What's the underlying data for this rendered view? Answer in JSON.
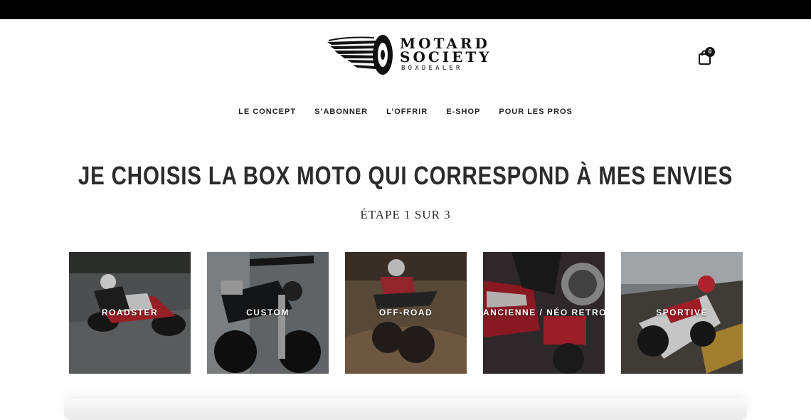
{
  "header": {
    "brand_line1": "MOTARD",
    "brand_line2": "SOCIETY",
    "brand_line3": "BOXDEALER",
    "cart_count": "0"
  },
  "nav": {
    "items": [
      {
        "label": "LE CONCEPT"
      },
      {
        "label": "S’ABONNER"
      },
      {
        "label": "L’OFFRIR"
      },
      {
        "label": "E-SHOP"
      },
      {
        "label": "POUR LES PROS"
      }
    ]
  },
  "main": {
    "headline": "JE CHOISIS LA BOX MOTO QUI CORRESPOND À MES ENVIES",
    "step": "ÉTAPE 1 SUR 3",
    "categories": [
      {
        "label": "ROADSTER"
      },
      {
        "label": "CUSTOM"
      },
      {
        "label": "OFF-ROAD"
      },
      {
        "label": "ANCIENNE / NÉO RETRO"
      },
      {
        "label": "SPORTIVE"
      }
    ]
  },
  "colors": {
    "topbar": "#000000",
    "text": "#222222",
    "tile_label": "#ffffff"
  },
  "icons": [
    "winged-wheel-logo-icon",
    "shopping-bag-icon"
  ]
}
